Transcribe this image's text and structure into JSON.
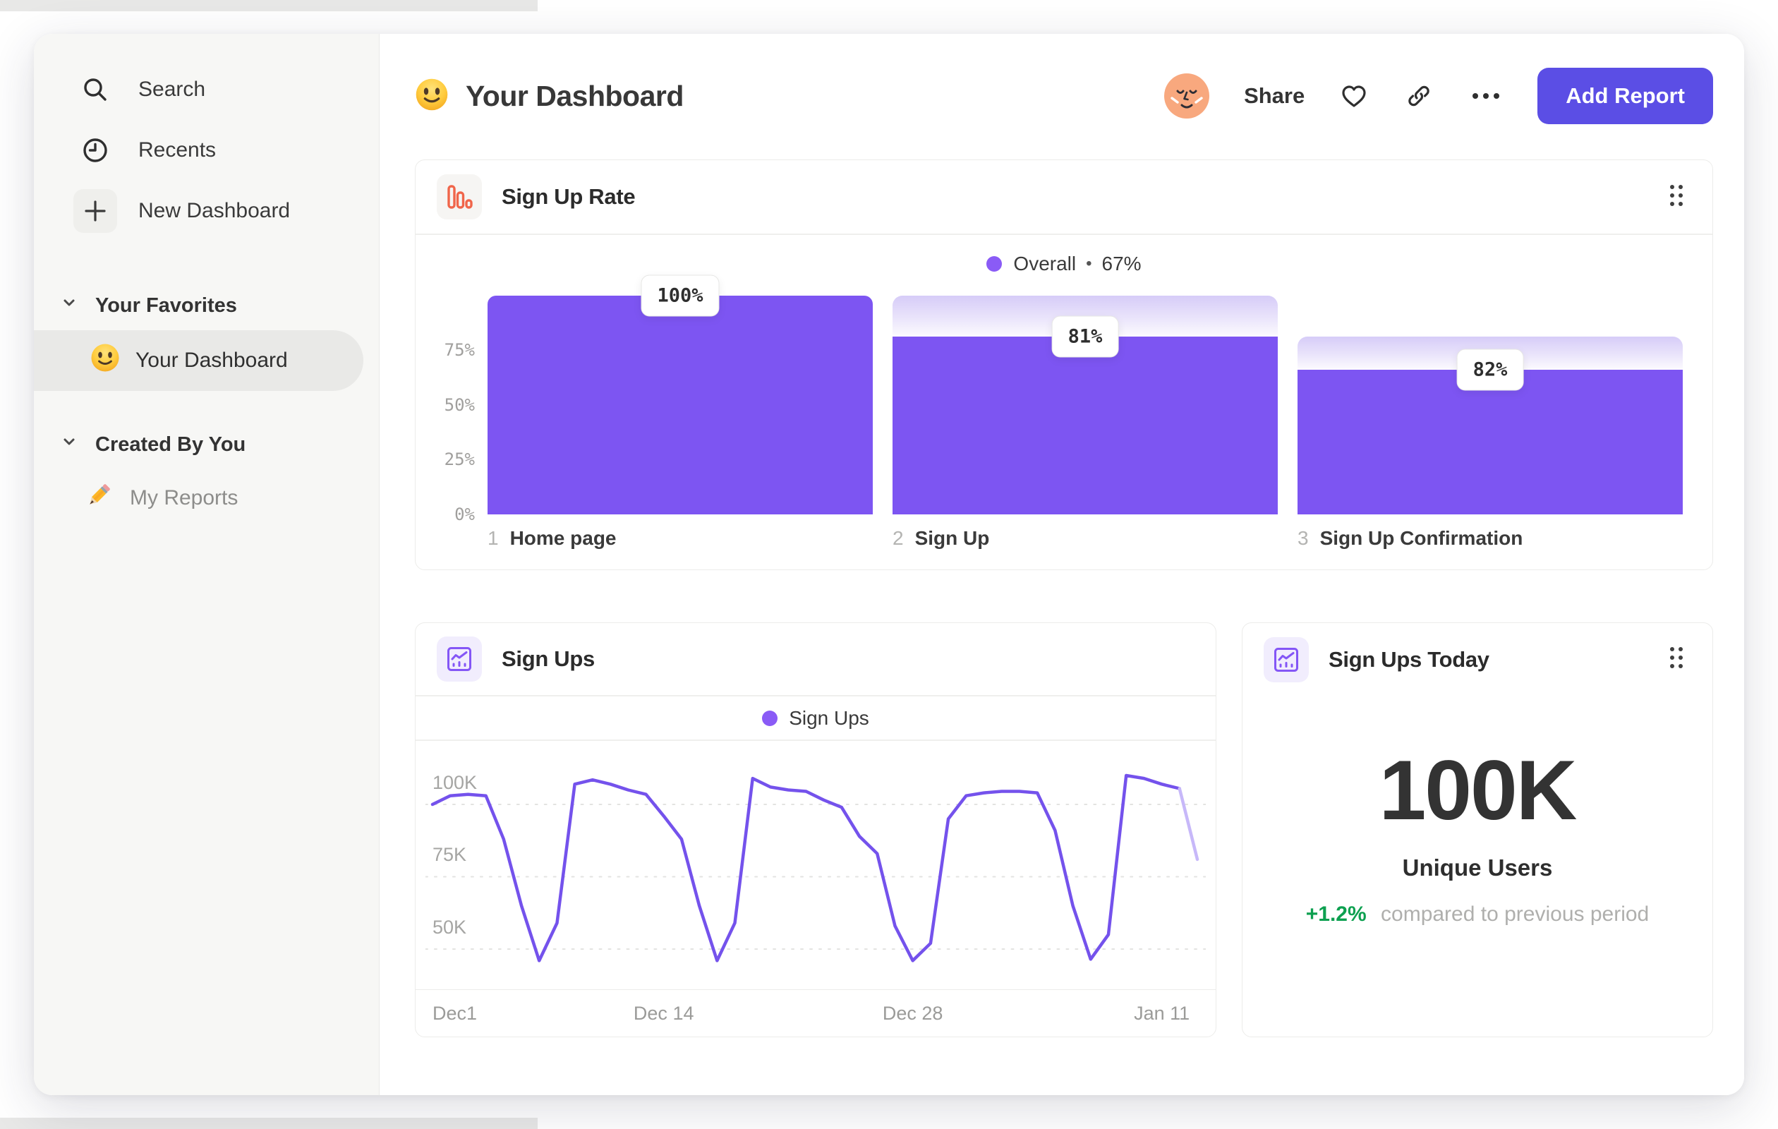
{
  "colors": {
    "accent": "#7D55F2",
    "button": "#5B4EE5",
    "coral": "#F0654A",
    "green": "#0DA050",
    "line": "#7452EC",
    "line_faded": "#C7B8F9",
    "legend_dot": "#8A5BF6"
  },
  "sidebar": {
    "items": [
      {
        "label": "Search"
      },
      {
        "label": "Recents"
      },
      {
        "label": "New Dashboard"
      }
    ],
    "sections": [
      {
        "label": "Your Favorites",
        "items": [
          {
            "label": "Your Dashboard",
            "selected": true
          }
        ]
      },
      {
        "label": "Created By You",
        "items": [
          {
            "label": "My Reports",
            "selected": false
          }
        ]
      }
    ]
  },
  "header": {
    "title": "Your Dashboard",
    "share_label": "Share",
    "add_report_label": "Add Report"
  },
  "cards": {
    "funnel": {
      "title": "Sign Up Rate"
    },
    "line": {
      "title": "Sign Ups"
    },
    "stat": {
      "title": "Sign Ups Today",
      "value": "100K",
      "label": "Unique Users",
      "delta": "+1.2%",
      "delta_note": "compared to previous period"
    }
  },
  "chart_data": [
    {
      "type": "bar",
      "title": "Sign Up Rate",
      "legend_name": "Overall",
      "legend_sep": "•",
      "legend_value": "67%",
      "legend_position": "top-center",
      "grid": false,
      "ylim": [
        0,
        100
      ],
      "yticks": [
        "75%",
        "50%",
        "25%",
        "0%"
      ],
      "steps": [
        {
          "num": "1",
          "label": "Home page",
          "badge": "100%",
          "solid_pct": 100,
          "ghost_pct": 100
        },
        {
          "num": "2",
          "label": "Sign Up",
          "badge": "81%",
          "solid_pct": 81,
          "ghost_pct": 100
        },
        {
          "num": "3",
          "label": "Sign Up Confirmation",
          "badge": "82%",
          "solid_pct": 66,
          "ghost_pct": 81
        }
      ]
    },
    {
      "type": "line",
      "title": "Sign Ups",
      "legend_name": "Sign Ups",
      "legend_position": "top-center",
      "grid": "dashed-horizontal",
      "unit": "K users per day",
      "ylim": [
        40,
        115
      ],
      "yticks": [
        {
          "label": "100K",
          "value": 100
        },
        {
          "label": "75K",
          "value": 75
        },
        {
          "label": "50K",
          "value": 50
        }
      ],
      "xticks": [
        {
          "label": "Dec1",
          "day": 0
        },
        {
          "label": "Dec 14",
          "day": 13
        },
        {
          "label": "Dec 28",
          "day": 27
        },
        {
          "label": "Jan 11",
          "day": 41
        }
      ],
      "faded_from": 42,
      "series": [
        {
          "name": "Sign Ups",
          "values": [
            100,
            103,
            103.5,
            103,
            88,
            65,
            46,
            59,
            107,
            108.5,
            107,
            105,
            103.5,
            96,
            88,
            65,
            46,
            59,
            109,
            106,
            105,
            104.5,
            101.5,
            99,
            89,
            83,
            58,
            46,
            52,
            95,
            103,
            104,
            104.5,
            104.5,
            104,
            91,
            65,
            46.5,
            55,
            110,
            109,
            107,
            105.5,
            81
          ]
        }
      ]
    },
    {
      "type": "table",
      "title": "Sign Ups Today",
      "value": 100,
      "value_display": "100K",
      "metric": "Unique Users",
      "delta_pct": 1.2,
      "delta_display": "+1.2%",
      "comparison": "compared to previous period"
    }
  ]
}
